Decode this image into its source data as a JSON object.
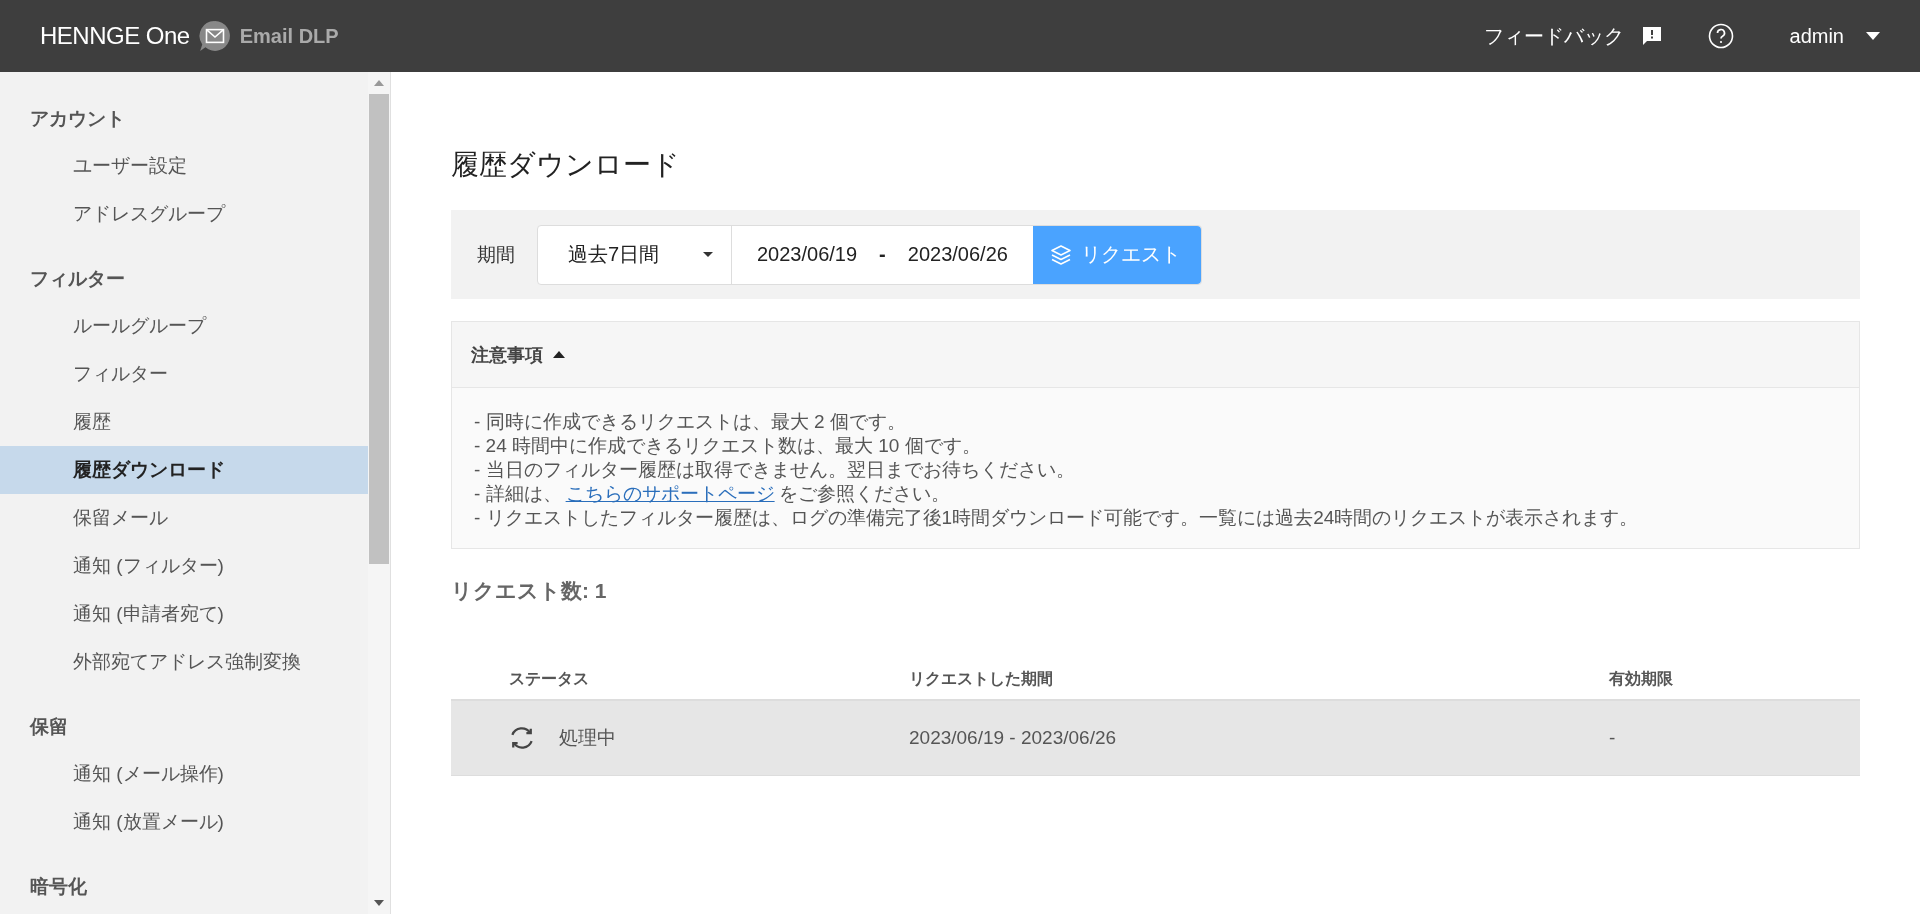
{
  "header": {
    "logo": "HENNGE One",
    "product": "Email DLP",
    "feedback": "フィードバック",
    "user": "admin"
  },
  "sidebar": {
    "sections": [
      {
        "title": "アカウント",
        "items": [
          {
            "label": "ユーザー設定",
            "selected": false
          },
          {
            "label": "アドレスグループ",
            "selected": false
          }
        ]
      },
      {
        "title": "フィルター",
        "items": [
          {
            "label": "ルールグループ",
            "selected": false
          },
          {
            "label": "フィルター",
            "selected": false
          },
          {
            "label": "履歴",
            "selected": false
          },
          {
            "label": "履歴ダウンロード",
            "selected": true
          },
          {
            "label": "保留メール",
            "selected": false
          },
          {
            "label": "通知 (フィルター)",
            "selected": false
          },
          {
            "label": "通知 (申請者宛て)",
            "selected": false
          },
          {
            "label": "外部宛てアドレス強制変換",
            "selected": false
          }
        ]
      },
      {
        "title": "保留",
        "items": [
          {
            "label": "通知 (メール操作)",
            "selected": false
          },
          {
            "label": "通知 (放置メール)",
            "selected": false
          }
        ]
      },
      {
        "title": "暗号化"
      }
    ]
  },
  "page_title": "履歴ダウンロード",
  "filter": {
    "label": "期間",
    "period": "過去7日間",
    "start_date": "2023/06/19",
    "separator": "-",
    "end_date": "2023/06/26",
    "button": "リクエスト"
  },
  "notice": {
    "title": "注意事項",
    "expanded": true,
    "lines": [
      {
        "text": "- 同時に作成できるリクエストは、最大 2 個です。"
      },
      {
        "text": "- 24 時間中に作成できるリクエスト数は、最大 10 個です。"
      },
      {
        "text": "- 当日のフィルター履歴は取得できません。翌日までお待ちください。"
      },
      {
        "text": "- 詳細は、",
        "link": "こちらのサポートページ",
        "after": "をご参照ください。"
      },
      {
        "text": "- リクエストしたフィルター履歴は、ログの準備完了後1時間ダウンロード可能です。一覧には過去24時間のリクエストが表示されます。"
      }
    ]
  },
  "request_count": "リクエスト数: 1",
  "table": {
    "columns": [
      "ステータス",
      "リクエストした期間",
      "有効期限"
    ],
    "rows": [
      {
        "status": "処理中",
        "period": "2023/06/19 - 2023/06/26",
        "expiry": "-"
      }
    ]
  }
}
